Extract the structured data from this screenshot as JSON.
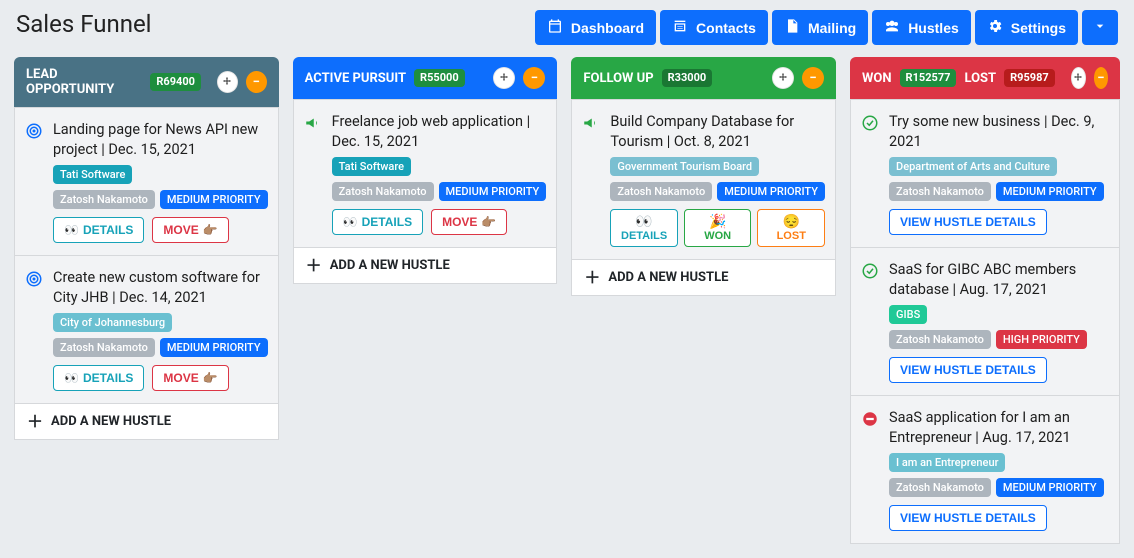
{
  "page": {
    "title": "Sales Funnel"
  },
  "nav": {
    "dashboard": "Dashboard",
    "contacts": "Contacts",
    "mailing": "Mailing",
    "hustles": "Hustles",
    "settings": "Settings"
  },
  "columns": {
    "lead": {
      "title": "LEAD OPPORTUNITY",
      "amount": "R69400",
      "add": "ADD A NEW HUSTLE",
      "cards": [
        {
          "title": "Landing page for News API new project | Dec. 15, 2021",
          "client": "Tati Software",
          "owner": "Zatosh Nakamoto",
          "priority": "MEDIUM PRIORITY",
          "details": "DETAILS",
          "move": "MOVE"
        },
        {
          "title": "Create new custom software for City JHB | Dec. 14, 2021",
          "client": "City of Johannesburg",
          "owner": "Zatosh Nakamoto",
          "priority": "MEDIUM PRIORITY",
          "details": "DETAILS",
          "move": "MOVE"
        }
      ]
    },
    "active": {
      "title": "ACTIVE PURSUIT",
      "amount": "R55000",
      "add": "ADD A NEW HUSTLE",
      "cards": [
        {
          "title": "Freelance job web application | Dec. 15, 2021",
          "client": "Tati Software",
          "owner": "Zatosh Nakamoto",
          "priority": "MEDIUM PRIORITY",
          "details": "DETAILS",
          "move": "MOVE"
        }
      ]
    },
    "follow": {
      "title": "FOLLOW UP",
      "amount": "R33000",
      "add": "ADD A NEW HUSTLE",
      "cards": [
        {
          "title": "Build Company Database for Tourism | Oct. 8, 2021",
          "client": "Government Tourism Board",
          "owner": "Zatosh Nakamoto",
          "priority": "MEDIUM PRIORITY",
          "details": "DETAILS",
          "won": "WON",
          "lost": "LOST"
        }
      ]
    },
    "won": {
      "title_won": "WON",
      "amount_won": "R152577",
      "title_lost": "LOST",
      "amount_lost": "R95987",
      "view": "VIEW HUSTLE DETAILS",
      "cards": [
        {
          "status": "won",
          "title": "Try some new business | Dec. 9, 2021",
          "client": "Department of Arts and Culture",
          "owner": "Zatosh Nakamoto",
          "priority": "MEDIUM PRIORITY"
        },
        {
          "status": "won",
          "title": "SaaS for GIBC ABC members database | Aug. 17, 2021",
          "client": "GIBS",
          "owner": "Zatosh Nakamoto",
          "priority": "HIGH PRIORITY"
        },
        {
          "status": "lost",
          "title": "SaaS application for I am an Entrepreneur | Aug. 17, 2021",
          "client": "I am an Entrepreneur",
          "owner": "Zatosh Nakamoto",
          "priority": "MEDIUM PRIORITY"
        }
      ]
    }
  }
}
